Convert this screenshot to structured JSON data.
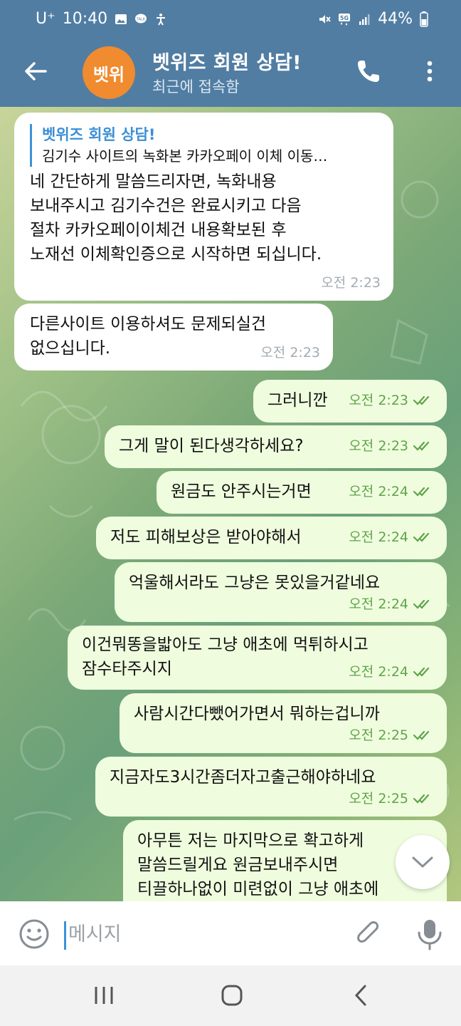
{
  "status_bar": {
    "carrier": "U⁺",
    "time": "10:40",
    "left_icons": [
      "image-icon",
      "talk-icon",
      "accessibility-icon"
    ],
    "right_icons": [
      "mute-icon",
      "5g-icon",
      "signal-icon"
    ],
    "battery": "44%"
  },
  "header": {
    "avatar_text": "벳위",
    "avatar_color": "#f08b2f",
    "title": "벳위즈 회원 상담!",
    "subtitle": "최근에 접속함",
    "bar_color": "#517da2"
  },
  "messages": [
    {
      "direction": "in",
      "reply_name": "벳위즈 회원 상담!",
      "reply_text": "김기수 사이트의 녹화본  카카오페이 이체 이동…",
      "text": "네 간단하게 말씀드리자면, 녹화내용\n보내주시고 김기수건은 완료시키고 다음\n절차 카카오페이이체건 내용확보된 후\n노재선 이체확인증으로 시작하면 되십니다.",
      "time": "오전 2:23"
    },
    {
      "direction": "in",
      "text": "다른사이트 이용하셔도 문제되실건\n없으십니다.",
      "time": "오전 2:23"
    },
    {
      "direction": "out",
      "text": "그러니깐",
      "time": "오전 2:23"
    },
    {
      "direction": "out",
      "text": "그게 말이 된다생각하세요?",
      "time": "오전 2:23"
    },
    {
      "direction": "out",
      "text": "원금도 안주시는거면",
      "time": "오전 2:24"
    },
    {
      "direction": "out",
      "text": "저도 피해보상은 받아야해서",
      "time": "오전 2:24"
    },
    {
      "direction": "out",
      "text": "억울해서라도 그냥은 못있을거같네요",
      "time": "오전 2:24"
    },
    {
      "direction": "out",
      "text": "이건뭐똥을밟아도 그냥 애초에 먹튀하시고\n잠수타주시지",
      "time": "오전 2:24"
    },
    {
      "direction": "out",
      "text": "사람시간다뺐어가면서 뭐하는겁니까",
      "time": "오전 2:25"
    },
    {
      "direction": "out",
      "text": "지금자도3시간좀더자고출근해야하네요",
      "time": "오전 2:25"
    },
    {
      "direction": "out",
      "text": "아무튼 저는 마지막으로 확고하게\n말씀드릴게요 원금보내주시면\n티끌하나없이 미련없이 그냥 애초에",
      "time": ""
    }
  ],
  "input": {
    "placeholder": "메시지"
  },
  "colors": {
    "incoming_bubble": "#ffffff",
    "outgoing_bubble": "#effdde",
    "outgoing_meta": "#5fa44a",
    "link_blue": "#3b8fd6"
  }
}
